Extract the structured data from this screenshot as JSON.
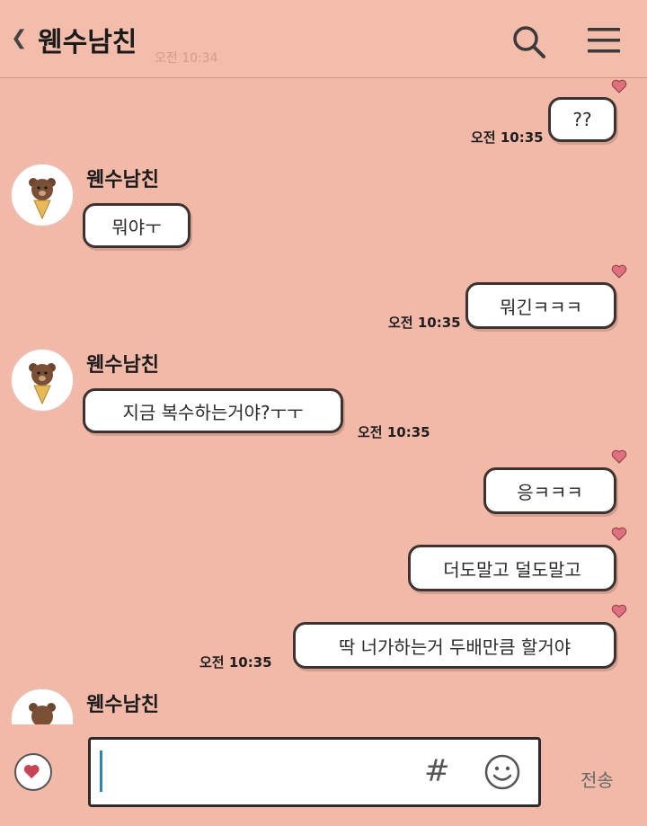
{
  "header": {
    "back_icon": "chevron-left-icon",
    "title": "웬수남친",
    "faint_time": "오전 10:34",
    "search_icon": "search-icon",
    "menu_icon": "hamburger-menu-icon"
  },
  "messages": [
    {
      "side": "right",
      "text": "??",
      "time": "오전 10:35"
    },
    {
      "side": "left",
      "sender": "웬수남친",
      "text": "뭐야ㅜ"
    },
    {
      "side": "right",
      "text": "뭐긴ㅋㅋㅋ",
      "time": "오전 10:35"
    },
    {
      "side": "left",
      "sender": "웬수남친",
      "text": "지금 복수하는거야?ㅜㅜ",
      "time": "오전 10:35"
    },
    {
      "side": "right",
      "text": "응ㅋㅋㅋ"
    },
    {
      "side": "right",
      "text": "더도말고 덜도말고"
    },
    {
      "side": "right",
      "text": "딱 너가하는거 두배만큼 할거야",
      "time": "오전 10:35"
    },
    {
      "side": "left",
      "sender": "웬수남친"
    }
  ],
  "composer": {
    "emoji_icon": "heart-emoticon-icon",
    "hash": "#",
    "smile_icon": "smile-icon",
    "send_label": "전송"
  },
  "colors": {
    "background": "#f2b9a8",
    "bubble": "#ffffff",
    "heart": "#e0707e",
    "caret": "#2c84b7"
  }
}
